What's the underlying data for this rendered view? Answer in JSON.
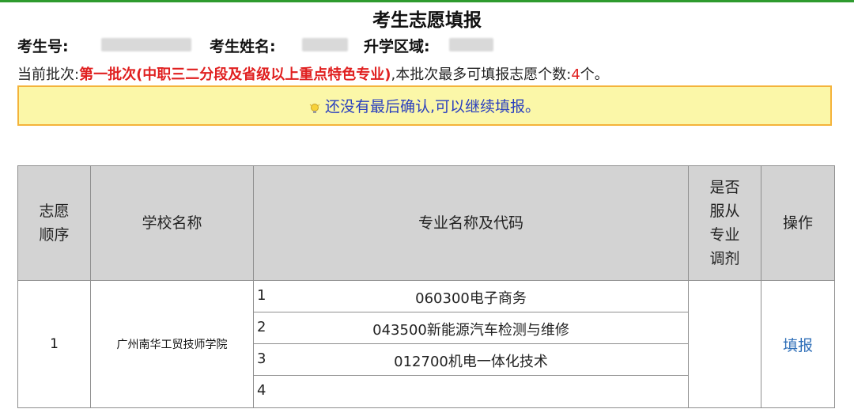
{
  "page": {
    "title": "考生志愿填报"
  },
  "candidate": {
    "id_label": "考生号:",
    "name_label": "考生姓名:",
    "region_label": "升学区域:"
  },
  "batch": {
    "prefix": "当前批次:",
    "name": "第一批次(中职三二分段及省级以上重点特色专业)",
    "middle": ",本批次最多可填报志愿个数:",
    "max_count": "4",
    "suffix": "个。"
  },
  "notice": {
    "icon": "lightbulb-icon",
    "text": "还没有最后确认,可以继续填报。"
  },
  "table": {
    "headers": {
      "order": "志愿顺序",
      "school": "学校名称",
      "major": "专业名称及代码",
      "adjust": "是否服从专业调剂",
      "action": "操作"
    },
    "rows": [
      {
        "order": "1",
        "school": "广州南华工贸技师学院",
        "majors": [
          {
            "no": "1",
            "name": "060300电子商务"
          },
          {
            "no": "2",
            "name": "043500新能源汽车检测与维修"
          },
          {
            "no": "3",
            "name": "012700机电一体化技术"
          },
          {
            "no": "4",
            "name": ""
          }
        ],
        "adjust": "",
        "action": "填报"
      }
    ]
  },
  "colors": {
    "top_line": "#2e9b2e",
    "batch_red": "#e02020",
    "notice_bg": "#fbf7a8",
    "notice_border": "#f4b33a",
    "notice_text": "#2a3fbf",
    "header_bg": "#d3d3d3",
    "link": "#2f6fb8"
  }
}
